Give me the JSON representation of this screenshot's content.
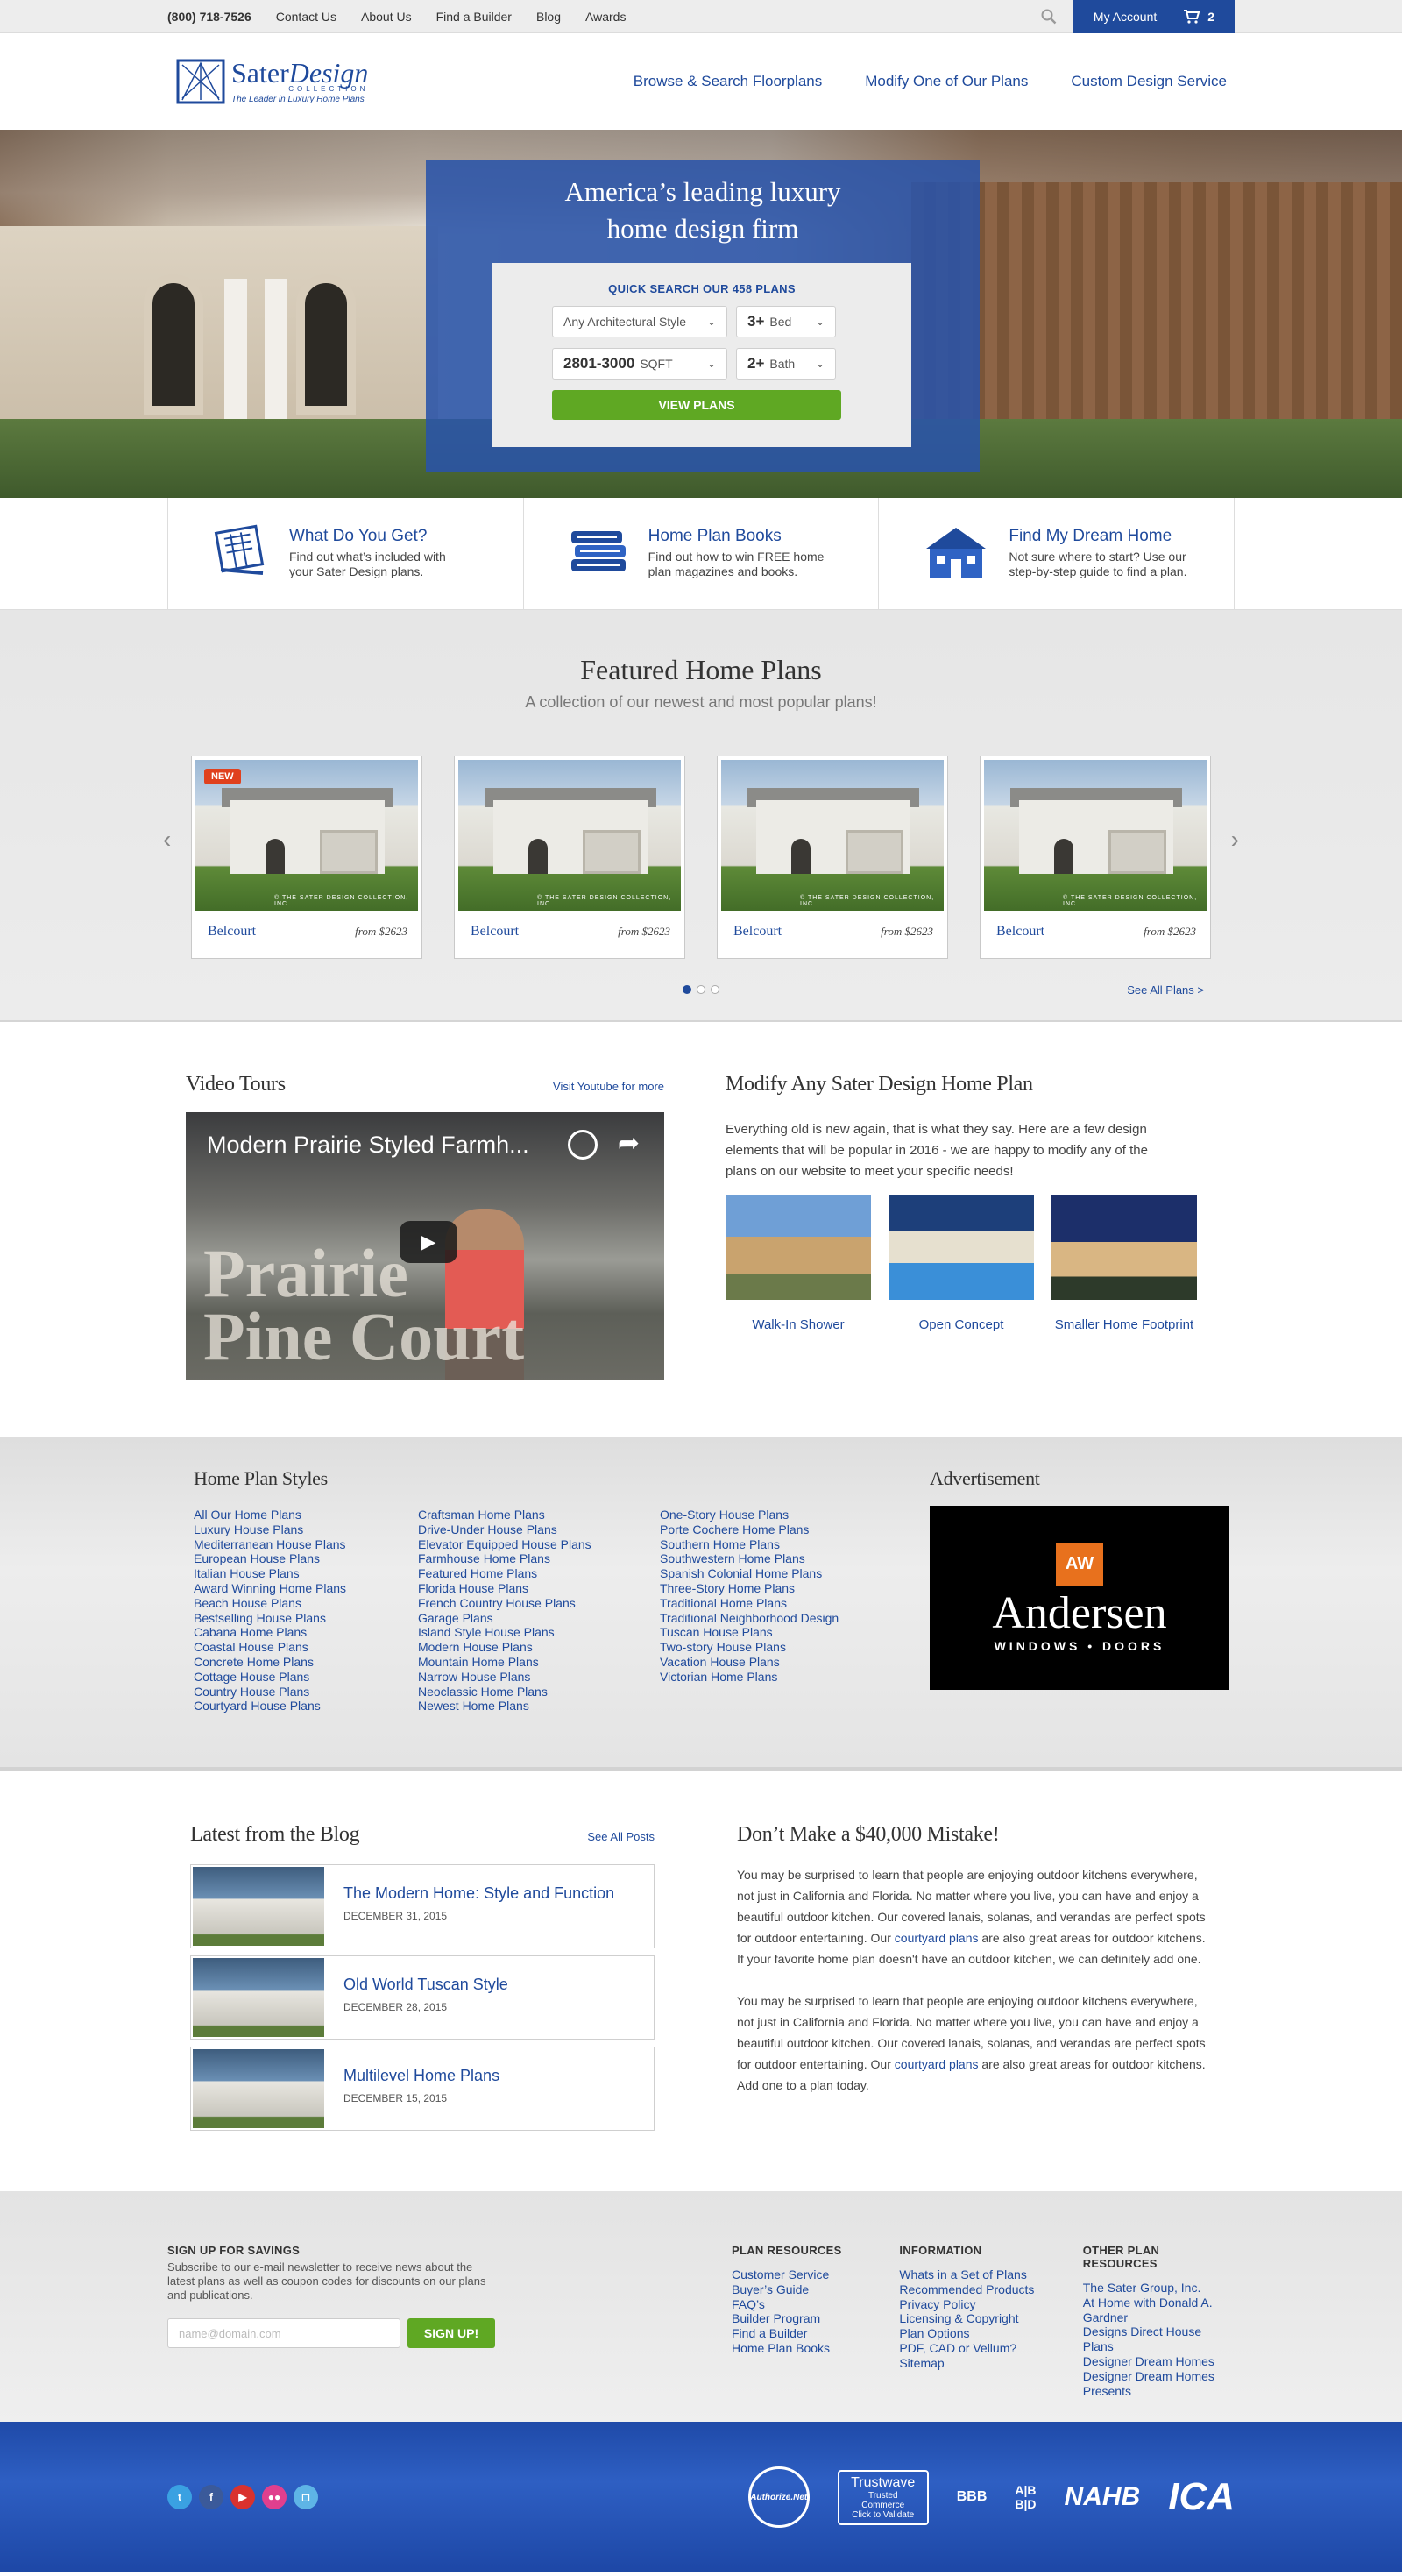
{
  "topbar": {
    "phone": "(800) 718-7526",
    "links": [
      "Contact Us",
      "About Us",
      "Find a Builder",
      "Blog",
      "Awards"
    ],
    "account_label": "My Account",
    "cart_count": "2"
  },
  "header": {
    "logo_sater": "Sater",
    "logo_design": "Design",
    "logo_collection": "COLLECTION",
    "logo_tagline": "The Leader in Luxury Home Plans",
    "nav": [
      "Browse & Search Floorplans",
      "Modify One of Our Plans",
      "Custom Design Service"
    ]
  },
  "hero": {
    "title_line1": "America’s leading luxury",
    "title_line2": "home design firm",
    "search_title": "QUICK SEARCH OUR 458 PLANS",
    "style_select": "Any Architectural Style",
    "bed_value": "3+",
    "bed_label": "Bed",
    "sqft_value": "2801-3000",
    "sqft_label": "SQFT",
    "bath_value": "2+",
    "bath_label": "Bath",
    "button": "VIEW PLANS"
  },
  "features": [
    {
      "title": "What Do You Get?",
      "desc1": "Find out what’s included with",
      "desc2": "your Sater Design plans.",
      "icon": "blueprint-icon"
    },
    {
      "title": "Home Plan Books",
      "desc1": "Find out how to win FREE home",
      "desc2": "plan magazines and books.",
      "icon": "books-icon"
    },
    {
      "title": "Find My Dream Home",
      "desc1": "Not sure where to start? Use our",
      "desc2": "step-by-step guide to find a plan.",
      "icon": "house-icon"
    }
  ],
  "featured": {
    "title": "Featured Home Plans",
    "subtitle": "A collection of our newest and most popular plans!",
    "badge_new": "NEW",
    "watermark": "© THE SATER DESIGN COLLECTION, INC.",
    "plans": [
      {
        "name": "Belcourt",
        "price": "from $2623"
      },
      {
        "name": "Belcourt",
        "price": "from $2623"
      },
      {
        "name": "Belcourt",
        "price": "from $2623"
      },
      {
        "name": "Belcourt",
        "price": "from $2623"
      }
    ],
    "see_all": "See All Plans >"
  },
  "video": {
    "title": "Video Tours",
    "link": "Visit Youtube for more",
    "video_title": "Modern Prairie Styled Farmh...",
    "overlay_line1": "Prairie",
    "overlay_line2": "Pine Court"
  },
  "modify": {
    "title": "Modify Any Sater Design Home Plan",
    "desc": "Everything old is new again, that is what they say. Here are a few design elements that will be popular in 2016 - we are happy to modify any of the plans on our website to meet your specific needs!",
    "items": [
      "Walk-In Shower",
      "Open Concept",
      "Smaller Home Footprint"
    ]
  },
  "styles": {
    "title": "Home Plan Styles",
    "col1": [
      "All Our Home Plans",
      "Luxury House Plans",
      "Mediterranean House Plans",
      "European House Plans",
      "Italian House Plans",
      "Award Winning Home Plans",
      "Beach House Plans",
      "Bestselling House Plans",
      "Cabana Home Plans",
      "Coastal House Plans",
      "Concrete Home Plans",
      "Cottage House Plans",
      "Country House Plans",
      "Courtyard House Plans"
    ],
    "col2": [
      "Craftsman Home Plans",
      "Drive-Under House Plans",
      "Elevator Equipped House Plans",
      "Farmhouse Home Plans",
      "Featured Home Plans",
      "Florida House Plans",
      "French Country House Plans",
      "Garage Plans",
      "Island Style House Plans",
      "Modern House Plans",
      "Mountain Home Plans",
      "Narrow House Plans",
      "Neoclassic Home Plans",
      "Newest Home Plans"
    ],
    "col3": [
      "One-Story House Plans",
      "Porte Cochere Home Plans",
      "Southern Home Plans",
      "Southwestern Home Plans",
      "Spanish Colonial Home Plans",
      "Three-Story Home Plans",
      "Traditional Home Plans",
      "Traditional Neighborhood Design",
      "Tuscan House Plans",
      "Two-story House Plans",
      "Vacation House Plans",
      "Victorian Home Plans"
    ]
  },
  "advertisement": {
    "title": "Advertisement",
    "logo_mark": "AW",
    "brand": "Andersen",
    "sub": "WINDOWS • DOORS"
  },
  "blog": {
    "title": "Latest from the Blog",
    "link": "See All Posts",
    "posts": [
      {
        "title": "The Modern Home: Style and Function",
        "date": "DECEMBER 31, 2015"
      },
      {
        "title": "Old World Tuscan Style",
        "date": "DECEMBER 28, 2015"
      },
      {
        "title": "Multilevel Home Plans",
        "date": "DECEMBER 15, 2015"
      }
    ]
  },
  "mistake": {
    "title": "Don’t Make a $40,000 Mistake!",
    "p1_a": "You may be surprised to learn that people are enjoying outdoor kitchens everywhere, not just in California and Florida. No matter where you live, you can have and enjoy a beautiful outdoor kitchen. Our covered lanais, solanas, and verandas are perfect spots for outdoor entertaining. Our ",
    "p1_link": "courtyard plans",
    "p1_b": " are also great areas for outdoor kitchens. If your favorite home plan doesn't have an outdoor kitchen, we can definitely add one.",
    "p2_a": "You may be surprised to learn that people are enjoying outdoor kitchens everywhere, not just in California and Florida. No matter where you live, you can have and enjoy a beautiful outdoor kitchen. Our covered lanais, solanas, and verandas are perfect spots for outdoor entertaining. Our ",
    "p2_link": "courtyard plans",
    "p2_b": " are also great areas for outdoor kitchens. Add one to a plan today."
  },
  "footer": {
    "signup_title": "SIGN UP FOR SAVINGS",
    "signup_desc": "Subscribe to our e-mail newsletter to receive news about the latest plans as well as coupon codes for discounts on our plans and publications.",
    "email_placeholder": "name@domain.com",
    "signup_button": "SIGN UP!",
    "plan_resources": {
      "title": "PLAN RESOURCES",
      "links": [
        "Customer Service",
        "Buyer’s Guide",
        "FAQ’s",
        "Builder Program",
        "Find a Builder",
        "Home Plan Books"
      ]
    },
    "information": {
      "title": "INFORMATION",
      "links": [
        "Whats in a Set of Plans",
        "Recommended Products",
        "Privacy Policy",
        "Licensing & Copyright",
        "Plan Options",
        "PDF, CAD or Vellum?",
        "Sitemap"
      ]
    },
    "other": {
      "title": "OTHER PLAN RESOURCES",
      "links": [
        "The Sater Group, Inc.",
        "At Home with Donald A. Gardner",
        "Designs Direct House Plans",
        "Designer Dream Homes",
        "Designer Dream Homes Presents"
      ]
    }
  },
  "band": {
    "social": [
      "t",
      "f",
      "▶",
      "●●",
      "◻"
    ],
    "authorize": "Authorize.Net",
    "trustwave_name": "Trustwave",
    "trustwave_sub": "Trusted Commerce",
    "trustwave_cta": "Click to Validate",
    "bbb": "BBB",
    "ab": "A|B\nB|D",
    "nahb": "NAHB",
    "ica": "ICA"
  },
  "colors": {
    "brand_blue": "#1f4a9c",
    "green": "#5fa823",
    "new_badge": "#e0411e"
  }
}
